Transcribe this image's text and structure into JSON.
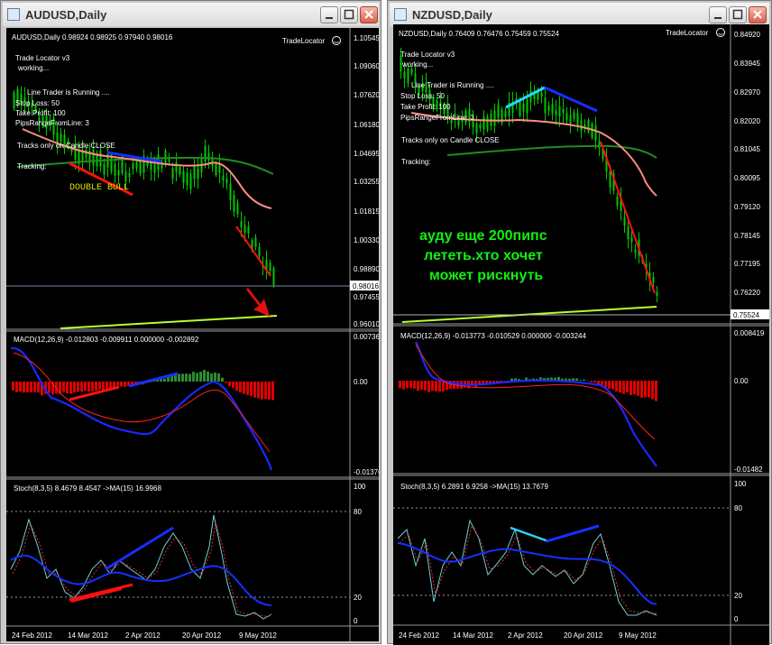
{
  "left_window": {
    "title": "AUDUSD,Daily",
    "info": "AUDUSD,Daily  0.98924 0.98925 0.97940 0.98016",
    "trade_locator": "TradeLocator",
    "overlay_lines": [
      "Trade Locator v3",
      "working...",
      "Line Trader is Running ....",
      "Stop Loss: 50",
      "Take Profit: 100",
      "PipsRangeFromLine: 3",
      "Tracks only on Candle CLOSE",
      "Tracking:"
    ],
    "double_label": "DOUBLE  BULL",
    "price_ticks": [
      "1.10545",
      "1.09060",
      "1.07620",
      "1.06180",
      "1.04695",
      "1.03255",
      "1.01815",
      "1.00330",
      "0.98890",
      "0.97455",
      "0.96010"
    ],
    "current_price": "0.98016",
    "macd_label": "MACD(12,26,9) -0.012803 -0.009911 0.000000 -0.002892",
    "macd_ticks": [
      "0.00736",
      "0.00",
      "-0.01376"
    ],
    "stoch_label": "Stoch(8,3,5) 8.4679 8.4547  ->MA(15) 16.9968",
    "stoch_ticks": [
      "100",
      "80",
      "20",
      "0"
    ],
    "dates": [
      "24 Feb 2012",
      "14 Mar 2012",
      "2 Apr 2012",
      "20 Apr 2012",
      "9 May 2012"
    ]
  },
  "right_window": {
    "title": "NZDUSD,Daily",
    "info": "NZDUSD,Daily  0.76409 0.76476 0.75459 0.75524",
    "trade_locator": "TradeLocator",
    "overlay_lines": [
      "Trade Locator v3",
      "working...",
      "Line Trader is Running ....",
      "Stop Loss: 50",
      "Take Profit: 100",
      "PipsRangeFromLine: 3",
      "Tracks only on Candle CLOSE",
      "Tracking:"
    ],
    "comment_lines": [
      "ауду еще 200пипс",
      "лететь.хто хочет",
      "может рискнуть"
    ],
    "price_ticks": [
      "0.84920",
      "0.83945",
      "0.82970",
      "0.82020",
      "0.81045",
      "0.80095",
      "0.79120",
      "0.78145",
      "0.77195",
      "0.76220"
    ],
    "current_price": "0.75524",
    "macd_label": "MACD(12,26,9) -0.013773 -0.010529 0.000000 -0.003244",
    "macd_ticks": [
      "0.008419",
      "0.00",
      "-0.01482"
    ],
    "stoch_label": "Stoch(8,3,5) 6.2891 6.9258  ->MA(15) 13.7679",
    "stoch_ticks": [
      "100",
      "80",
      "20",
      "0"
    ],
    "dates": [
      "24 Feb 2012",
      "14 Mar 2012",
      "2 Apr 2012",
      "20 Apr 2012",
      "9 May 2012"
    ]
  },
  "colors": {
    "candles": "#00c800",
    "ema_fast": "#ff8c82",
    "ema_slow": "#228b22",
    "trend_red": "#ff1010",
    "trend_blue": "#1530ff",
    "trend_cyan": "#2ad4ff",
    "macd_hist_neg": "#e00000",
    "macd_hist_pos": "#2e8b2e",
    "comment_green": "#10f010"
  }
}
